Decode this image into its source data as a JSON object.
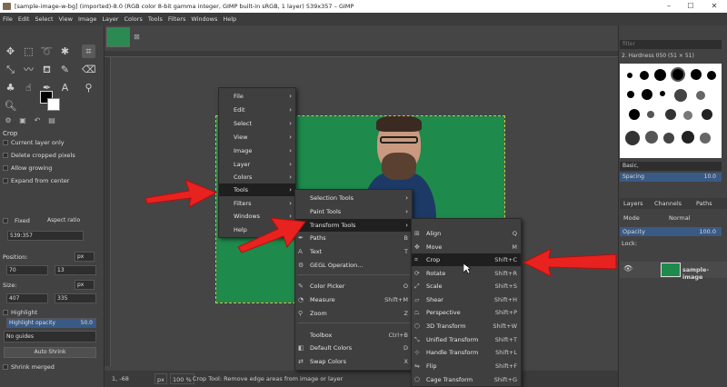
{
  "window": {
    "title": "[sample-image-w-bg] (imported)-8.0 (RGB color 8-bit gamma integer, GIMP built-in sRGB, 1 layer) 539x357 – GIMP",
    "minimize": "–",
    "maximize": "☐",
    "close": "✕"
  },
  "menubar": [
    "File",
    "Edit",
    "Select",
    "View",
    "Image",
    "Layer",
    "Colors",
    "Tools",
    "Filters",
    "Windows",
    "Help"
  ],
  "tool_options": {
    "title": "Crop",
    "current_layer_only": "Current layer only",
    "delete_cropped": "Delete cropped pixels",
    "allow_growing": "Allow growing",
    "expand_from_center": "Expand from center",
    "fixed": "Fixed",
    "aspect_ratio": "Aspect ratio",
    "ratio_value": "539:357",
    "position_label": "Position:",
    "pos_x": "70",
    "pos_y": "13",
    "pos_unit": "px",
    "size_label": "Size:",
    "size_w": "407",
    "size_h": "335",
    "size_unit": "px",
    "highlight": "Highlight",
    "highlight_opacity_label": "Highlight opacity",
    "highlight_opacity_value": "50.0",
    "guides": "No guides",
    "auto_shrink": "Auto Shrink",
    "shrink_merged": "Shrink merged"
  },
  "status": {
    "coords": "1, -68",
    "unit": "px",
    "zoom": "100 %",
    "message": "Crop Tool: Remove edge areas from image or layer"
  },
  "brushes": {
    "filter_placeholder": "filter",
    "brush_name": "2. Hardness 050 (51 × 51)",
    "preset": "Basic,",
    "spacing_label": "Spacing",
    "spacing_value": "10.0"
  },
  "layers_panel": {
    "tabs": [
      "Layers",
      "Channels",
      "Paths"
    ],
    "mode_label": "Mode",
    "mode_value": "Normal",
    "opacity_label": "Opacity",
    "opacity_value": "100.0",
    "lock_label": "Lock:",
    "layer_name": "sample-image"
  },
  "menu_main": [
    {
      "label": "File",
      "arrow": "›"
    },
    {
      "label": "Edit",
      "arrow": "›"
    },
    {
      "label": "Select",
      "arrow": "›"
    },
    {
      "label": "View",
      "arrow": "›"
    },
    {
      "label": "Image",
      "arrow": "›"
    },
    {
      "label": "Layer",
      "arrow": "›"
    },
    {
      "label": "Colors",
      "arrow": "›"
    },
    {
      "label": "Tools",
      "arrow": "›"
    },
    {
      "label": "Filters",
      "arrow": "›"
    },
    {
      "label": "Windows",
      "arrow": "›"
    },
    {
      "label": "Help",
      "arrow": "›"
    }
  ],
  "menu_tools": [
    {
      "label": "Selection Tools",
      "right": "›"
    },
    {
      "label": "Paint Tools",
      "right": "›"
    },
    {
      "label": "Transform Tools",
      "right": "›"
    },
    {
      "label": "Paths",
      "right": "B"
    },
    {
      "label": "Text",
      "right": "T"
    },
    {
      "label": "GEGL Operation...",
      "right": ""
    },
    {
      "label": "Color Picker",
      "right": "O"
    },
    {
      "label": "Measure",
      "right": "Shift+M"
    },
    {
      "label": "Zoom",
      "right": "Z"
    },
    {
      "label": "Toolbox",
      "right": "Ctrl+B"
    },
    {
      "label": "Default Colors",
      "right": "D"
    },
    {
      "label": "Swap Colors",
      "right": "X"
    }
  ],
  "menu_transform": [
    {
      "label": "Align",
      "right": "Q"
    },
    {
      "label": "Move",
      "right": "M"
    },
    {
      "label": "Crop",
      "right": "Shift+C"
    },
    {
      "label": "Rotate",
      "right": "Shift+R"
    },
    {
      "label": "Scale",
      "right": "Shift+S"
    },
    {
      "label": "Shear",
      "right": "Shift+H"
    },
    {
      "label": "Perspective",
      "right": "Shift+P"
    },
    {
      "label": "3D Transform",
      "right": "Shift+W"
    },
    {
      "label": "Unified Transform",
      "right": "Shift+T"
    },
    {
      "label": "Handle Transform",
      "right": "Shift+L"
    },
    {
      "label": "Flip",
      "right": "Shift+F"
    },
    {
      "label": "Cage Transform",
      "right": "Shift+G"
    }
  ]
}
